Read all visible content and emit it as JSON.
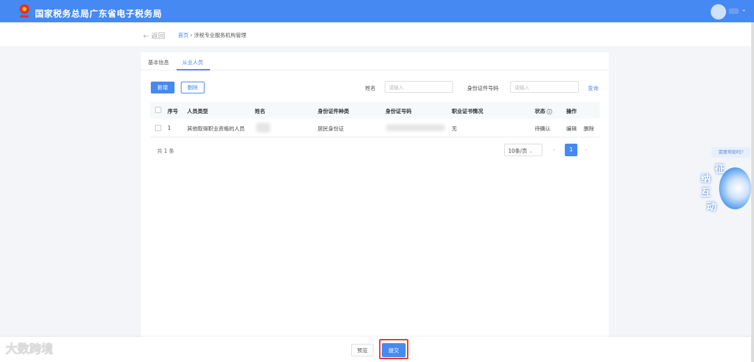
{
  "header": {
    "title": "国家税务总局广东省电子税务局"
  },
  "breadcrumb": {
    "back": "← 返回",
    "home": "首页",
    "sep": "›",
    "current": "涉税专业服务机构管理"
  },
  "tabs": [
    {
      "label": "基本信息"
    },
    {
      "label": "从业人员"
    }
  ],
  "toolbar": {
    "add": "新增",
    "delete": "删除"
  },
  "filters": {
    "name_label": "姓名",
    "name_placeholder": "请输入",
    "id_label": "身份证件号码",
    "id_placeholder": "请输入",
    "search": "查询"
  },
  "table": {
    "headers": [
      "序号",
      "人员类型",
      "姓名",
      "身份证件种类",
      "身份证号码",
      "职业证书情况",
      "状态",
      "操作"
    ],
    "rows": [
      {
        "index": "1",
        "type": "其他取得职业资格的人员",
        "id_type": "居民身份证",
        "cert": "无",
        "status": "待确认",
        "edit": "编辑",
        "delete": "删除"
      }
    ]
  },
  "pagination": {
    "total": "共 1 条",
    "page_size": "10条/页",
    "current": "1"
  },
  "help": {
    "bubble": "需要帮助吗?",
    "chars": [
      "征",
      "纳",
      "互",
      "动"
    ]
  },
  "footer": {
    "preview": "预览",
    "submit": "提交"
  },
  "watermark": "大数跨境"
}
